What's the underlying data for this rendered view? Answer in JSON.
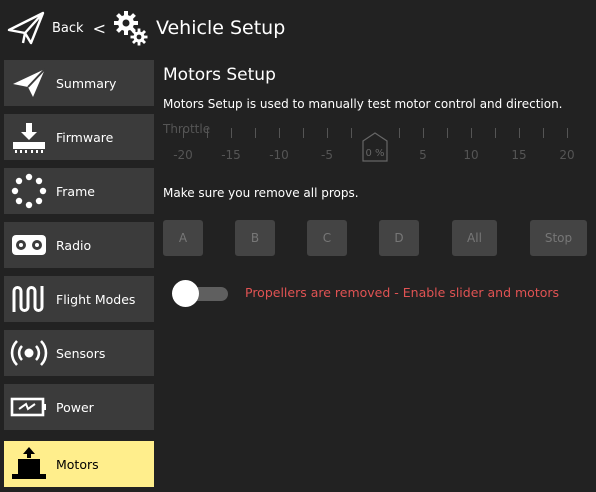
{
  "header": {
    "back_label": "Back",
    "separator": "<",
    "title": "Vehicle Setup"
  },
  "sidebar": {
    "items": [
      {
        "label": "Summary",
        "icon": "paper-plane-icon"
      },
      {
        "label": "Firmware",
        "icon": "firmware-download-icon"
      },
      {
        "label": "Frame",
        "icon": "frame-dots-icon"
      },
      {
        "label": "Radio",
        "icon": "radio-icon"
      },
      {
        "label": "Flight Modes",
        "icon": "flight-modes-icon"
      },
      {
        "label": "Sensors",
        "icon": "sensors-icon"
      },
      {
        "label": "Power",
        "icon": "power-battery-icon"
      },
      {
        "label": "Motors",
        "icon": "motors-icon"
      }
    ],
    "active": "Motors"
  },
  "motors": {
    "title": "Motors Setup",
    "description": "Motors Setup is used to manually test motor control and direction.",
    "throttle_label": "Throttle",
    "slider_ticks": [
      "-20",
      "-15",
      "-10",
      "-5",
      "0",
      "5",
      "10",
      "15",
      "20"
    ],
    "slider_value": "0 %",
    "warning": "Make sure you remove all props.",
    "buttons": [
      "A",
      "B",
      "C",
      "D",
      "All",
      "Stop"
    ],
    "toggle_on": false,
    "status": "Propellers are removed - Enable slider and motors"
  },
  "colors": {
    "background": "#222222",
    "active_item": "#ffee8c",
    "status_text": "#e05353"
  }
}
